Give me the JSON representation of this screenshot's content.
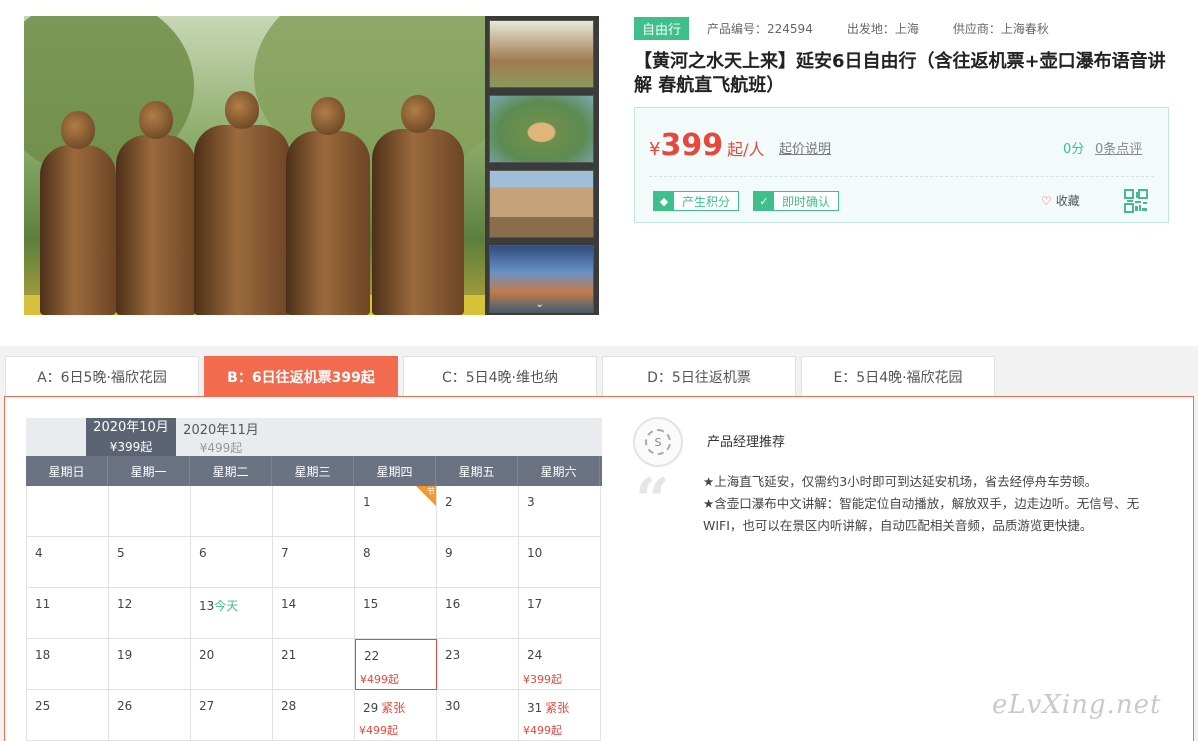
{
  "product": {
    "tag": "自由行",
    "code_label": "产品编号：224594",
    "departure_label": "出发地：上海",
    "supplier_label": "供应商：上海春秋",
    "title": "【黄河之水天上来】延安6日自由行（含往返机票+壶口瀑布语音讲解 春航直飞航班）"
  },
  "price": {
    "currency": "¥",
    "amount": "399",
    "unit": "起/人",
    "explain": "起价说明",
    "score": "0分",
    "reviews": "0条点评"
  },
  "badges": [
    {
      "icon": "diamond-icon",
      "label": "产生积分"
    },
    {
      "icon": "check-icon",
      "label": "即时确认"
    }
  ],
  "favorite": "收藏",
  "tabs": [
    {
      "label": "A：6日5晚·福欣花园"
    },
    {
      "label": "B：6日往返机票399起"
    },
    {
      "label": "C：5日4晚·维也纳"
    },
    {
      "label": "D：5日往返机票"
    },
    {
      "label": "E：5日4晚·福欣花园"
    }
  ],
  "calendar": {
    "months": [
      {
        "name": "2020年10月",
        "price": "¥399起"
      },
      {
        "name": "2020年11月",
        "price": "¥499起"
      }
    ],
    "weekdays": [
      "星期日",
      "星期一",
      "星期二",
      "星期三",
      "星期四",
      "星期五",
      "星期六"
    ],
    "holiday_mark": "节",
    "today_label": "今天",
    "rows": [
      [
        {
          "day": ""
        },
        {
          "day": ""
        },
        {
          "day": ""
        },
        {
          "day": ""
        },
        {
          "day": "1",
          "holiday": true
        },
        {
          "day": "2"
        },
        {
          "day": "3"
        }
      ],
      [
        {
          "day": "4"
        },
        {
          "day": "5"
        },
        {
          "day": "6"
        },
        {
          "day": "7"
        },
        {
          "day": "8"
        },
        {
          "day": "9"
        },
        {
          "day": "10"
        }
      ],
      [
        {
          "day": "11"
        },
        {
          "day": "12"
        },
        {
          "day": "13",
          "today": true
        },
        {
          "day": "14"
        },
        {
          "day": "15"
        },
        {
          "day": "16"
        },
        {
          "day": "17"
        }
      ],
      [
        {
          "day": "18"
        },
        {
          "day": "19"
        },
        {
          "day": "20"
        },
        {
          "day": "21"
        },
        {
          "day": "22",
          "price": "¥499起",
          "selected": true
        },
        {
          "day": "23"
        },
        {
          "day": "24",
          "price": "¥399起"
        }
      ],
      [
        {
          "day": "25"
        },
        {
          "day": "26"
        },
        {
          "day": "27"
        },
        {
          "day": "28"
        },
        {
          "day": "29",
          "status": "紧张",
          "price": "¥499起"
        },
        {
          "day": "30"
        },
        {
          "day": "31",
          "status": "紧张",
          "price": "¥499起"
        }
      ]
    ]
  },
  "recommend": {
    "title": "产品经理推荐",
    "lines": [
      "★上海直飞延安，仅需约3小时即可到达延安机场，省去经停舟车劳顿。",
      "★含壶口瀑布中文讲解：智能定位自动播放，解放双手，边走边听。无信号、无WIFI，也可以在景区内听讲解，自动匹配相关音频，品质游览更快捷。"
    ]
  },
  "watermark": "eLvXing.net",
  "colors": {
    "accent": "#f36b4e",
    "green": "#3fbf8c",
    "price": "#e8473c"
  }
}
